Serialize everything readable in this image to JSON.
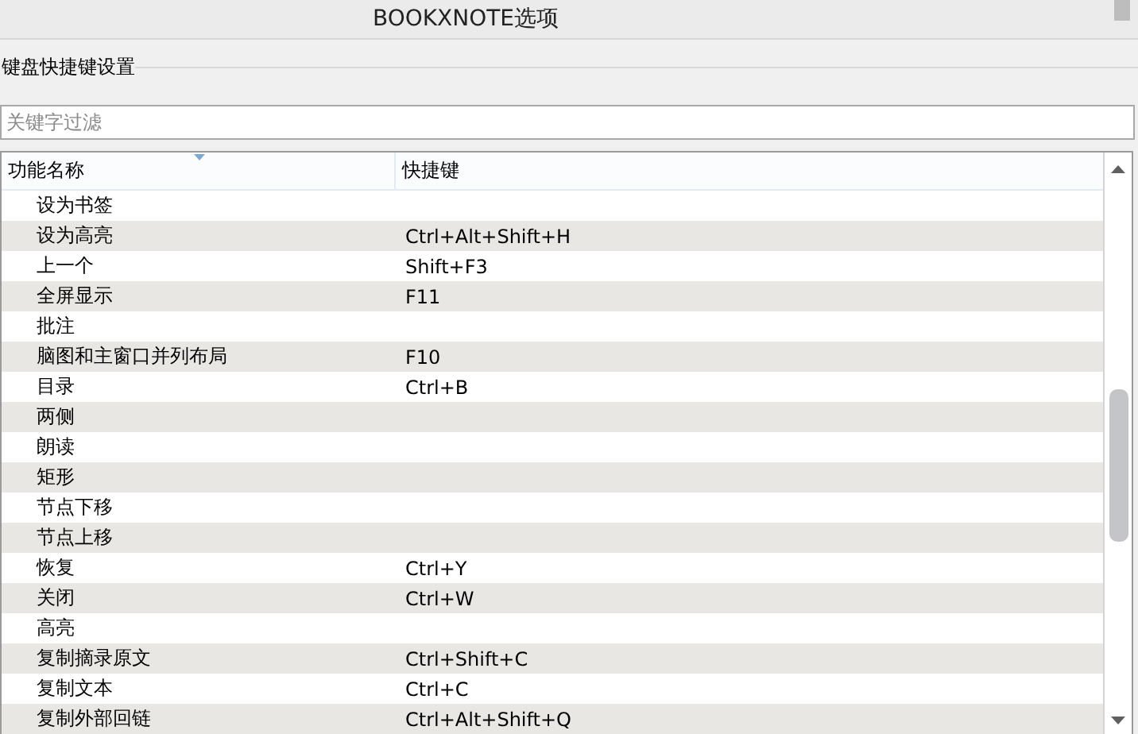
{
  "window": {
    "title": "BOOKXNOTE选项"
  },
  "group": {
    "label": "键盘快捷键设置"
  },
  "filter": {
    "placeholder": "关键字过滤"
  },
  "table": {
    "columns": [
      {
        "label": "功能名称",
        "sorted": true
      },
      {
        "label": "快捷键",
        "sorted": false
      }
    ],
    "rows": [
      {
        "name": "设为书签",
        "shortcut": ""
      },
      {
        "name": "设为高亮",
        "shortcut": "Ctrl+Alt+Shift+H"
      },
      {
        "name": "上一个",
        "shortcut": "Shift+F3"
      },
      {
        "name": "全屏显示",
        "shortcut": "F11"
      },
      {
        "name": "批注",
        "shortcut": ""
      },
      {
        "name": "脑图和主窗口并列布局",
        "shortcut": "F10"
      },
      {
        "name": "目录",
        "shortcut": "Ctrl+B"
      },
      {
        "name": "两侧",
        "shortcut": ""
      },
      {
        "name": "朗读",
        "shortcut": ""
      },
      {
        "name": "矩形",
        "shortcut": ""
      },
      {
        "name": "节点下移",
        "shortcut": ""
      },
      {
        "name": "节点上移",
        "shortcut": ""
      },
      {
        "name": "恢复",
        "shortcut": "Ctrl+Y"
      },
      {
        "name": "关闭",
        "shortcut": "Ctrl+W"
      },
      {
        "name": "高亮",
        "shortcut": ""
      },
      {
        "name": "复制摘录原文",
        "shortcut": "Ctrl+Shift+C"
      },
      {
        "name": "复制文本",
        "shortcut": "Ctrl+C"
      },
      {
        "name": "复制外部回链",
        "shortcut": "Ctrl+Alt+Shift+Q"
      }
    ]
  }
}
